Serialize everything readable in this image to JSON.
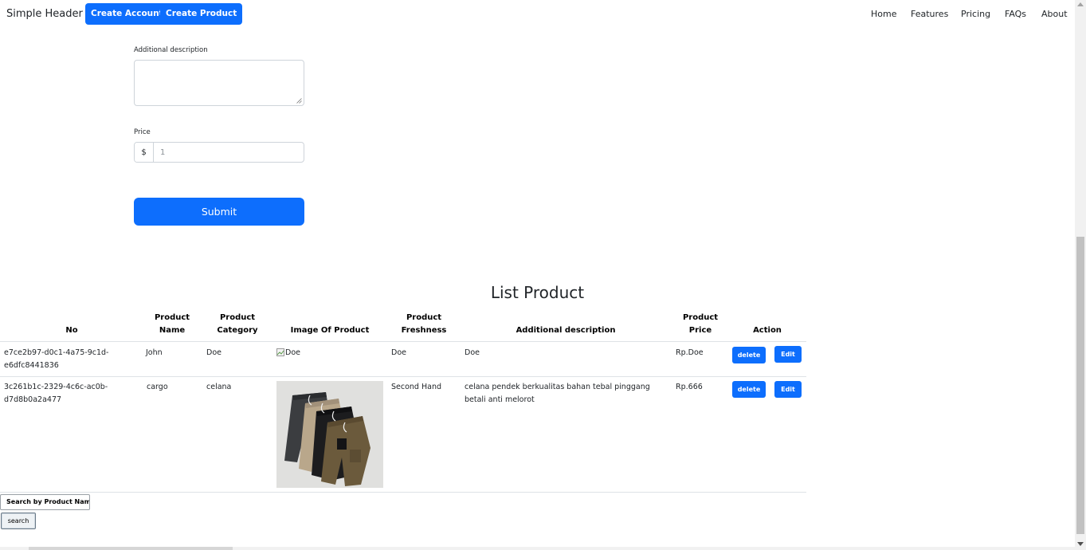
{
  "header": {
    "brand": "Simple Header",
    "create_account": "Create Account",
    "create_product": "Create Product",
    "nav": [
      "Home",
      "Features",
      "Pricing",
      "FAQs",
      "About"
    ]
  },
  "form": {
    "additional_description_label": "Additional description",
    "price_label": "Price",
    "price_prefix": "$",
    "price_value": "1",
    "submit_label": "Submit"
  },
  "list": {
    "title": "List Product",
    "headers": [
      "No",
      "Product Name",
      "Product Category",
      "Image Of Product",
      "Product Freshness",
      "Additional description",
      "Product Price",
      "Action"
    ],
    "headers_split": {
      "product_name": [
        "Product",
        "Name"
      ],
      "product_category": [
        "Product",
        "Category"
      ],
      "product_freshness": [
        "Product",
        "Freshness"
      ],
      "product_price": [
        "Product",
        "Price"
      ]
    },
    "rows": [
      {
        "no": "e7ce2b97-d0c1-4a75-9c1d-e6dfc8441836",
        "no_lines": [
          "e7ce2b97-d0c1-4a75-9c1d-",
          "e6dfc8441836"
        ],
        "name": "John",
        "category": "Doe",
        "image_alt": "Doe",
        "freshness": "Doe",
        "description": "Doe",
        "price": "Rp.Doe",
        "delete_label": "delete",
        "edit_label": "Edit"
      },
      {
        "no": "3c261b1c-2329-4c6c-ac0b-d7d8b0a2a477",
        "no_lines": [
          "3c261b1c-2329-4c6c-ac0b-",
          "d7d8b0a2a477"
        ],
        "name": "cargo",
        "category": "celana",
        "image_alt": "",
        "freshness": "Second Hand",
        "description": "celana pendek berkualitas bahan tebal pinggang betali anti melorot",
        "description_lines": [
          "celana pendek berkualitas bahan tebal pinggang",
          "betali anti melorot"
        ],
        "price": "Rp.666",
        "delete_label": "delete",
        "edit_label": "Edit"
      }
    ]
  },
  "search": {
    "placeholder": "Search by Product Name",
    "button_label": "search"
  },
  "colors": {
    "primary": "#0d6efd",
    "border": "#dee2e6"
  }
}
